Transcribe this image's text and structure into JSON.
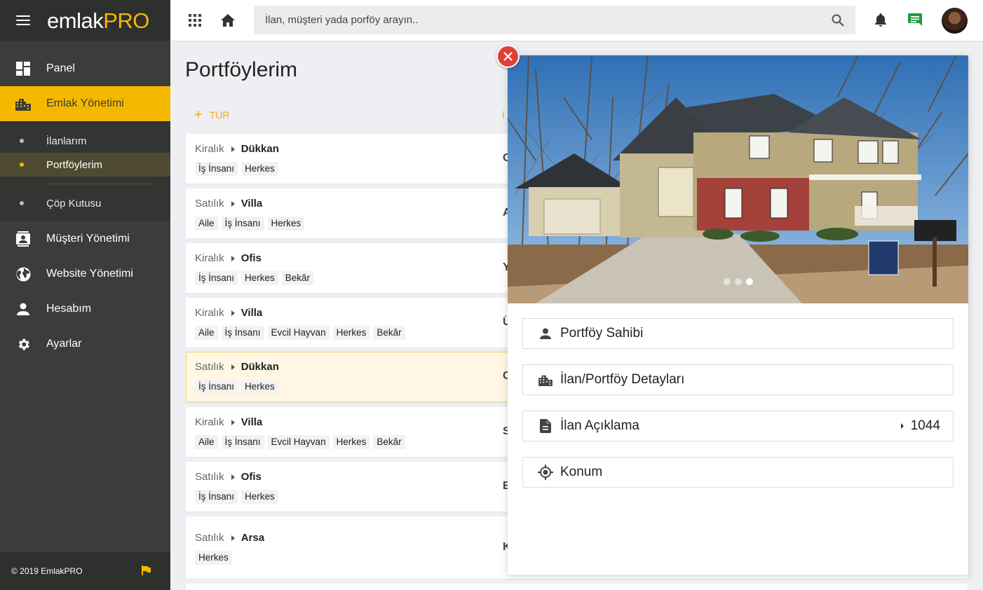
{
  "sidebar": {
    "logo_part1": "emlak",
    "logo_part2": "PRO",
    "nav_top": [
      {
        "label": "Panel",
        "icon": "dashboard-icon"
      },
      {
        "label": "Emlak Yönetimi",
        "icon": "buildings-icon"
      }
    ],
    "sub_items": [
      {
        "label": "İlanlarım"
      },
      {
        "label": "Portföylerim"
      },
      {
        "label": "Çöp Kutusu"
      }
    ],
    "nav_bottom": [
      {
        "label": "Müşteri Yönetimi",
        "icon": "contacts-icon"
      },
      {
        "label": "Website Yönetimi",
        "icon": "globe-icon"
      },
      {
        "label": "Hesabım",
        "icon": "person-icon"
      },
      {
        "label": "Ayarlar",
        "icon": "gear-icon"
      }
    ],
    "footer": "© 2019 EmlakPRO",
    "accent": "#f5b800"
  },
  "topbar": {
    "search_placeholder": "İlan, müşteri yada porföy arayın.."
  },
  "main": {
    "title": "Portföylerim",
    "add_type_label": "TÜR",
    "peek_header": "İ",
    "cards": [
      {
        "status": "Kiralık",
        "type": "Dükkan",
        "tags": [
          "İş İnsanı",
          "Herkes"
        ],
        "peek": "C"
      },
      {
        "status": "Satılık",
        "type": "Villa",
        "tags": [
          "Aile",
          "İş İnsanı",
          "Herkes"
        ],
        "peek": "A"
      },
      {
        "status": "Kiralık",
        "type": "Ofis",
        "tags": [
          "İş İnsanı",
          "Herkes",
          "Bekâr"
        ],
        "peek": "Y"
      },
      {
        "status": "Kiralık",
        "type": "Villa",
        "tags": [
          "Aile",
          "İş İnsanı",
          "Evcil Hayvan",
          "Herkes",
          "Bekâr"
        ],
        "peek": "Ü"
      },
      {
        "status": "Satılık",
        "type": "Dükkan",
        "tags": [
          "İş İnsanı",
          "Herkes"
        ],
        "peek": "C"
      },
      {
        "status": "Kiralık",
        "type": "Villa",
        "tags": [
          "Aile",
          "İş İnsanı",
          "Evcil Hayvan",
          "Herkes",
          "Bekâr"
        ],
        "peek": "S"
      },
      {
        "status": "Satılık",
        "type": "Ofis",
        "tags": [
          "İş İnsanı",
          "Herkes"
        ],
        "peek": "E"
      },
      {
        "status": "Satılık",
        "type": "Arsa",
        "tags": [
          "Herkes"
        ],
        "peek": "K"
      }
    ]
  },
  "detail": {
    "slides_total": 3,
    "slide_active": 3,
    "sections": [
      {
        "label": "Portföy Sahibi",
        "icon": "person-icon",
        "value": ""
      },
      {
        "label": "İlan/Portföy Detayları",
        "icon": "buildings-icon",
        "value": ""
      },
      {
        "label": "İlan Açıklama",
        "icon": "document-icon",
        "value": "1044"
      },
      {
        "label": "Konum",
        "icon": "location-target-icon",
        "value": ""
      }
    ]
  }
}
